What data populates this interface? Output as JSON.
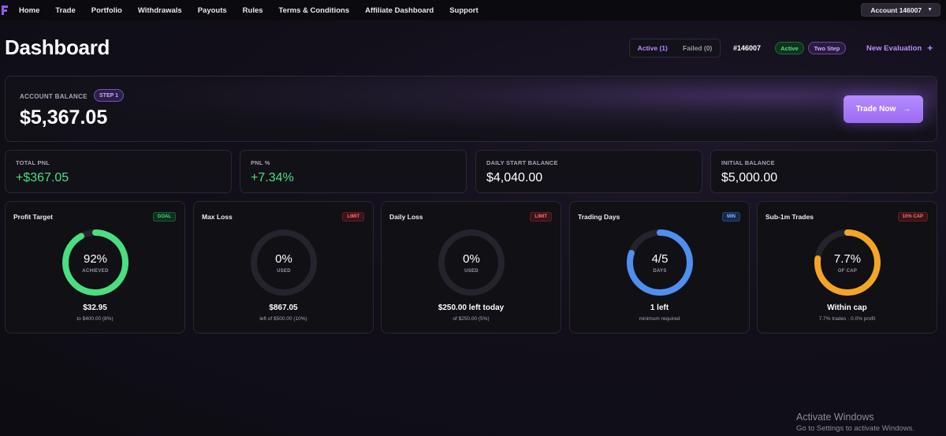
{
  "nav": {
    "items": [
      "Home",
      "Trade",
      "Portfolio",
      "Withdrawals",
      "Payouts",
      "Rules",
      "Terms & Conditions",
      "Affiliate Dashboard",
      "Support"
    ],
    "account_label": "Account 146007",
    "caret_icon": "caret-down-icon"
  },
  "header": {
    "title": "Dashboard",
    "tabs": [
      "Active (1)",
      "Failed (0)"
    ],
    "account_id": "#146007",
    "status_pill": "Active",
    "step_pill": "Two Step",
    "new_eval": "New Evaluation",
    "new_eval_icon": "+"
  },
  "balance": {
    "label": "ACCOUNT BALANCE",
    "badge": "STEP 1",
    "value": "$5,367.05",
    "trade_button": "Trade Now",
    "trade_icon": "→"
  },
  "stats": [
    {
      "label": "TOTAL PNL",
      "value": "+$367.05",
      "positive": true
    },
    {
      "label": "PNL %",
      "value": "+7.34%",
      "positive": true
    },
    {
      "label": "DAILY START BALANCE",
      "value": "$4,040.00",
      "positive": false
    },
    {
      "label": "INITIAL BALANCE",
      "value": "$5,000.00",
      "positive": false
    }
  ],
  "metrics": [
    {
      "title": "Profit Target",
      "badge": "GOAL",
      "pct": "92%",
      "sub": "ACHIEVED",
      "value": "$32.95",
      "note": "to $400.00 (8%)",
      "fraction": 0.92,
      "color": "#4ade80"
    },
    {
      "title": "Max Loss",
      "badge": "LIMIT",
      "pct": "0%",
      "sub": "USED",
      "value": "$867.05",
      "note": "left of $500.00 (10%)",
      "fraction": 0,
      "color": "#f87171"
    },
    {
      "title": "Daily Loss",
      "badge": "LIMIT",
      "pct": "0%",
      "sub": "USED",
      "value": "$250.00 left today",
      "note": "of $250.00 (5%)",
      "fraction": 0,
      "color": "#f87171"
    },
    {
      "title": "Trading Days",
      "badge": "MIN",
      "pct": "4/5",
      "sub": "DAYS",
      "value": "1 left",
      "note": "minimum required",
      "fraction": 0.8,
      "color": "#4f8ff0"
    },
    {
      "title": "Sub-1m Trades",
      "badge": "10% CAP",
      "pct": "7.7%",
      "sub": "OF CAP",
      "value": "Within cap",
      "note": "7.7% trades · 0.0% profit",
      "fraction": 0.77,
      "color": "#f5a524"
    }
  ],
  "watermark": {
    "title": "Activate Windows",
    "subtitle": "Go to Settings to activate Windows."
  }
}
